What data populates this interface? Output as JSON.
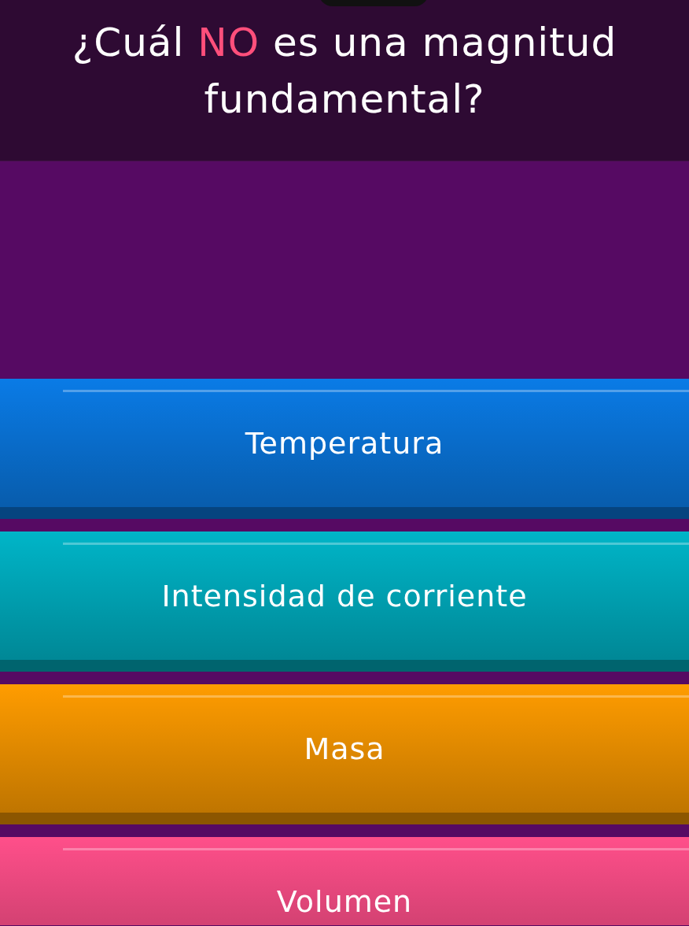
{
  "question": {
    "before": "¿Cuál ",
    "highlight": "NO",
    "after": " es una magnitud fundamental?"
  },
  "answers": [
    {
      "label": "Temperatura",
      "color": "#0a7be6"
    },
    {
      "label": "Intensidad de corriente",
      "color": "#00b5c8"
    },
    {
      "label": "Masa",
      "color": "#ff9c00"
    },
    {
      "label": "Volumen",
      "color": "#ff4f8a"
    }
  ]
}
